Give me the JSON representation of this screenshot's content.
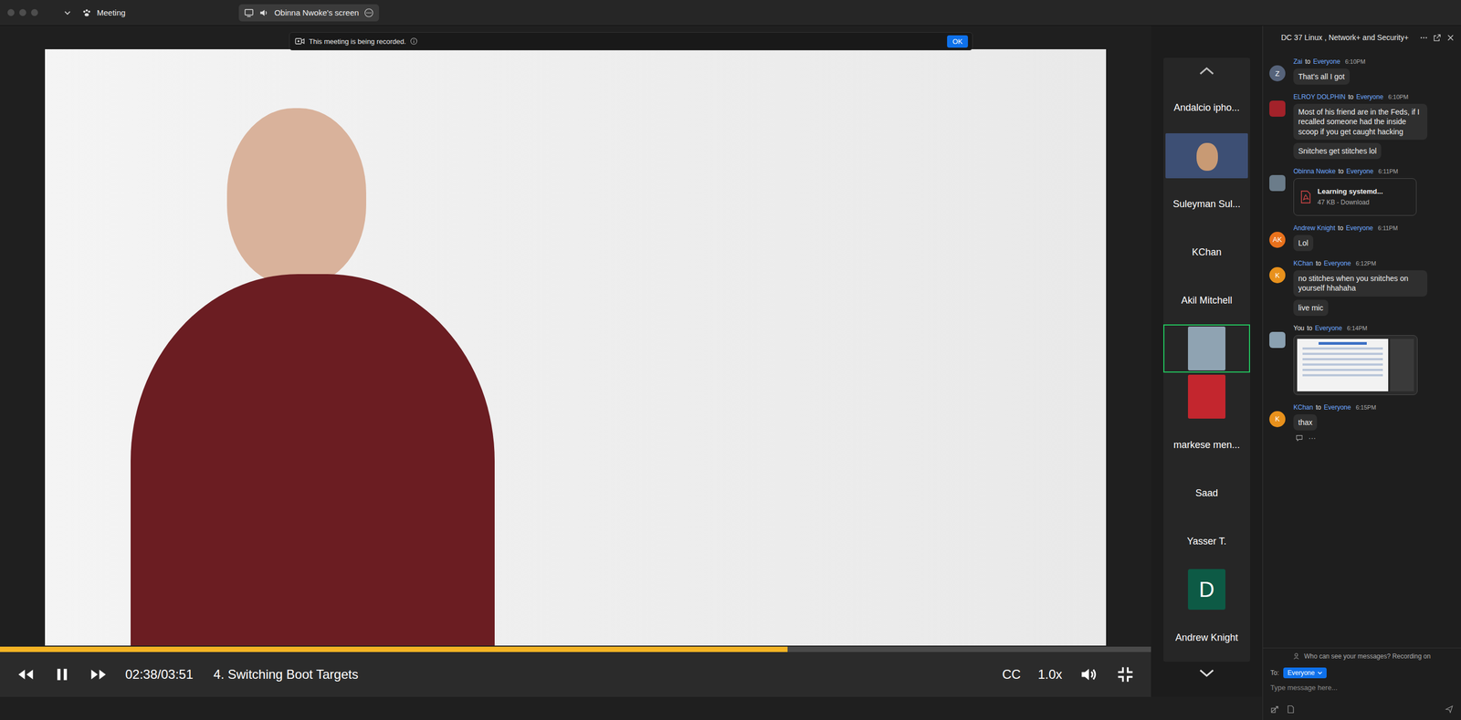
{
  "window": {
    "title": "Meeting"
  },
  "share_pill": {
    "label": "Obinna Nwoke's screen"
  },
  "banner": {
    "text": "This meeting is being recorded.",
    "button": "OK"
  },
  "player": {
    "level": 0.684,
    "playing": true,
    "time": "02:38/03:51",
    "title": "4. Switching Boot Targets",
    "cc": "CC",
    "speed": "1.0x"
  },
  "participants": [
    {
      "kind": "name",
      "name": "Andalcio ipho...",
      "selected": false
    },
    {
      "kind": "video",
      "color": "#3d4f74",
      "selected": false
    },
    {
      "kind": "name",
      "name": "Suleyman Sul...",
      "selected": false
    },
    {
      "kind": "name",
      "name": "KChan",
      "selected": false
    },
    {
      "kind": "name",
      "name": "Akil Mitchell",
      "selected": false
    },
    {
      "kind": "picture",
      "color": "#8fa3b2",
      "selected": true
    },
    {
      "kind": "picture",
      "color": "#c3262e",
      "selected": false
    },
    {
      "kind": "name",
      "name": "markese men...",
      "selected": false
    },
    {
      "kind": "name",
      "name": "Saad",
      "selected": false
    },
    {
      "kind": "name",
      "name": "Yasser T.",
      "selected": false
    },
    {
      "kind": "letter",
      "name": "D",
      "color": "#0d5a45",
      "selected": false
    },
    {
      "kind": "name",
      "name": "Andrew Knight",
      "selected": false
    }
  ],
  "chat": {
    "title": "DC 37 Linux , Network+ and Security+",
    "connector": "to",
    "messages": [
      {
        "sender": "Zai",
        "is_self": false,
        "recipient": "Everyone",
        "time": "6:10PM",
        "avatar": {
          "kind": "letter",
          "text": "Z",
          "color": "#56637a"
        },
        "parts": [
          {
            "kind": "text",
            "text": "That's all I got"
          }
        ]
      },
      {
        "sender": "ELROY DOLPHIN",
        "is_self": false,
        "recipient": "Everyone",
        "time": "6:10PM",
        "avatar": {
          "kind": "picture",
          "color": "#a3222a"
        },
        "parts": [
          {
            "kind": "text",
            "text": "Most of his friend are in the Feds, if I recalled someone had the inside scoop if you get caught hacking"
          },
          {
            "kind": "text",
            "text": "Snitches get stitches lol"
          }
        ]
      },
      {
        "sender": "Obinna Nwoke",
        "is_self": false,
        "recipient": "Everyone",
        "time": "6:11PM",
        "avatar": {
          "kind": "picture",
          "color": "#6b7c8a"
        },
        "parts": [
          {
            "kind": "file",
            "name": "Learning systemd...",
            "meta": "47 KB - Download"
          }
        ]
      },
      {
        "sender": "Andrew Knight",
        "is_self": false,
        "recipient": "Everyone",
        "time": "6:11PM",
        "avatar": {
          "kind": "letter",
          "text": "AK",
          "color": "#e8711c"
        },
        "parts": [
          {
            "kind": "text",
            "text": "Lol"
          }
        ]
      },
      {
        "sender": "KChan",
        "is_self": false,
        "recipient": "Everyone",
        "time": "6:12PM",
        "avatar": {
          "kind": "letter",
          "text": "K",
          "color": "#e8911c"
        },
        "parts": [
          {
            "kind": "text",
            "text": "no stitches when you snitches on yourself  hhahaha"
          },
          {
            "kind": "text",
            "text": "live mic"
          }
        ]
      },
      {
        "sender": "You",
        "is_self": true,
        "recipient": "Everyone",
        "time": "6:14PM",
        "avatar": {
          "kind": "picture",
          "color": "#8aa0b0"
        },
        "parts": [
          {
            "kind": "image"
          }
        ]
      },
      {
        "sender": "KChan",
        "is_self": false,
        "recipient": "Everyone",
        "time": "6:15PM",
        "avatar": {
          "kind": "letter",
          "text": "K",
          "color": "#e8911c"
        },
        "parts": [
          {
            "kind": "text",
            "text": "thax"
          }
        ],
        "actions": {
          "more": "···"
        }
      }
    ],
    "privacy_note": "Who can see your messages? Recording on",
    "to_label": "To:",
    "recipient": "Everyone",
    "placeholder": "Type message here..."
  }
}
